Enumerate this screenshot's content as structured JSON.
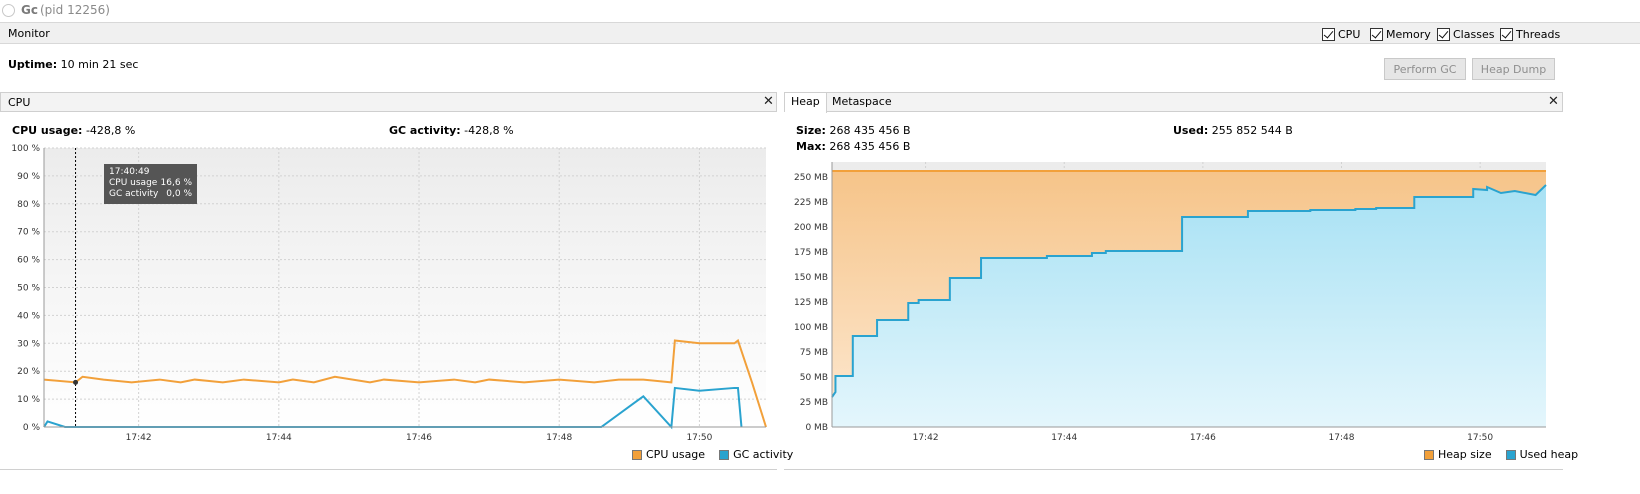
{
  "window": {
    "app_name": "Gc",
    "pid": "(pid 12256)"
  },
  "monitor": {
    "label": "Monitor",
    "checkboxes": [
      {
        "label": "CPU",
        "checked": true
      },
      {
        "label": "Memory",
        "checked": true
      },
      {
        "label": "Classes",
        "checked": true
      },
      {
        "label": "Threads",
        "checked": true
      }
    ],
    "uptime_label": "Uptime:",
    "uptime_value": "10 min 21 sec",
    "perform_gc": "Perform GC",
    "heap_dump": "Heap Dump"
  },
  "cpu_panel": {
    "title": "CPU",
    "close": "✕",
    "cpu_usage_label": "CPU usage:",
    "cpu_usage_value": "-428,8 %",
    "gc_activity_label": "GC activity:",
    "gc_activity_value": "-428,8 %",
    "tooltip": {
      "time": "17:40:49",
      "cpu_label": "CPU usage",
      "cpu_value": "16,6 %",
      "gc_label": "GC activity",
      "gc_value": "0,0 %"
    },
    "legend": [
      {
        "label": "CPU usage",
        "color": "#f2a03a"
      },
      {
        "label": "GC activity",
        "color": "#2aa3cf"
      }
    ]
  },
  "heap_panel": {
    "tabs": [
      {
        "label": "Heap",
        "selected": true
      },
      {
        "label": "Metaspace",
        "selected": false
      }
    ],
    "close": "✕",
    "size_label": "Size:",
    "size_value": "268 435 456 B",
    "max_label": "Max:",
    "max_value": "268 435 456 B",
    "used_label": "Used:",
    "used_value": "255 852 544 B",
    "legend": [
      {
        "label": "Heap size",
        "color": "#f2a03a"
      },
      {
        "label": "Used heap",
        "color": "#2aa3cf"
      }
    ]
  },
  "chart_data": [
    {
      "type": "line",
      "x_ticks": [
        "17:42",
        "17:44",
        "17:46",
        "17:48",
        "17:50"
      ],
      "y_ticks": [
        "0 %",
        "10 %",
        "20 %",
        "30 %",
        "40 %",
        "50 %",
        "60 %",
        "70 %",
        "80 %",
        "90 %",
        "100 %"
      ],
      "ylim": [
        0,
        100
      ],
      "xlim_minutes": [
        -1.35,
        8.95
      ],
      "grid": true,
      "legend_position": "bottom-right",
      "series": [
        {
          "name": "CPU usage",
          "color": "#f2a03a",
          "x": [
            -1.35,
            -0.9,
            -0.8,
            -0.5,
            -0.1,
            0.3,
            0.6,
            0.8,
            1.2,
            1.5,
            2.0,
            2.2,
            2.5,
            2.8,
            3.3,
            3.5,
            4.0,
            4.5,
            4.8,
            5.0,
            5.5,
            6.0,
            6.5,
            6.85,
            6.95,
            7.2,
            7.6,
            7.65,
            8.0,
            8.5,
            8.55,
            8.75,
            8.95
          ],
          "y": [
            17,
            16,
            18,
            17,
            16,
            17,
            16,
            17,
            16,
            17,
            16,
            17,
            16,
            18,
            16,
            17,
            16,
            17,
            16,
            17,
            16,
            17,
            16,
            17,
            17,
            17,
            16,
            31,
            30,
            30,
            31,
            16,
            0
          ]
        },
        {
          "name": "GC activity",
          "color": "#2aa3cf",
          "x": [
            -1.35,
            -1.3,
            -1.05,
            -0.6,
            -0.1,
            0.55,
            1.4,
            2.3,
            3.1,
            4.2,
            4.8,
            5.0,
            5.9,
            6.6,
            7.2,
            7.6,
            7.65,
            8.0,
            8.5,
            8.55,
            8.6
          ],
          "y": [
            0,
            2,
            0,
            0,
            0,
            0,
            0,
            0,
            0,
            0,
            0,
            0,
            0,
            0,
            11,
            0,
            14,
            13,
            14,
            14,
            0
          ]
        }
      ]
    },
    {
      "type": "area",
      "x_ticks": [
        "17:42",
        "17:44",
        "17:46",
        "17:48",
        "17:50"
      ],
      "y_ticks": [
        "0 MB",
        "25 MB",
        "50 MB",
        "75 MB",
        "100 MB",
        "125 MB",
        "150 MB",
        "175 MB",
        "200 MB",
        "225 MB",
        "250 MB"
      ],
      "ylim": [
        0,
        265
      ],
      "xlim_minutes": [
        -1.35,
        8.95
      ],
      "grid": true,
      "legend_position": "bottom-right",
      "series": [
        {
          "name": "Heap size",
          "color": "#f2a03a",
          "x": [
            -1.35,
            8.95
          ],
          "y": [
            256,
            256
          ]
        },
        {
          "name": "Used heap",
          "color": "#2aa3cf",
          "x": [
            -1.35,
            -1.3,
            -1.3,
            -1.05,
            -1.05,
            -0.7,
            -0.7,
            -0.25,
            -0.25,
            -0.1,
            -0.1,
            0.35,
            0.35,
            0.8,
            0.8,
            0.95,
            0.95,
            1.75,
            1.75,
            2.4,
            2.4,
            2.6,
            2.6,
            2.75,
            2.75,
            3.7,
            3.7,
            4.05,
            4.05,
            4.65,
            4.65,
            5.55,
            5.55,
            6.2,
            6.2,
            6.5,
            6.5,
            7.05,
            7.05,
            7.9,
            7.9,
            8.1,
            8.1,
            8.3,
            8.5,
            8.8,
            8.95
          ],
          "y": [
            30,
            35,
            51,
            51,
            91,
            91,
            107,
            107,
            124,
            124,
            127,
            127,
            149,
            149,
            169,
            169,
            169,
            169,
            171,
            171,
            174,
            174,
            176,
            176,
            176,
            176,
            210,
            210,
            210,
            210,
            216,
            216,
            217,
            217,
            218,
            218,
            219,
            219,
            230,
            230,
            238,
            237,
            240,
            234,
            236,
            232,
            242
          ]
        }
      ]
    }
  ]
}
